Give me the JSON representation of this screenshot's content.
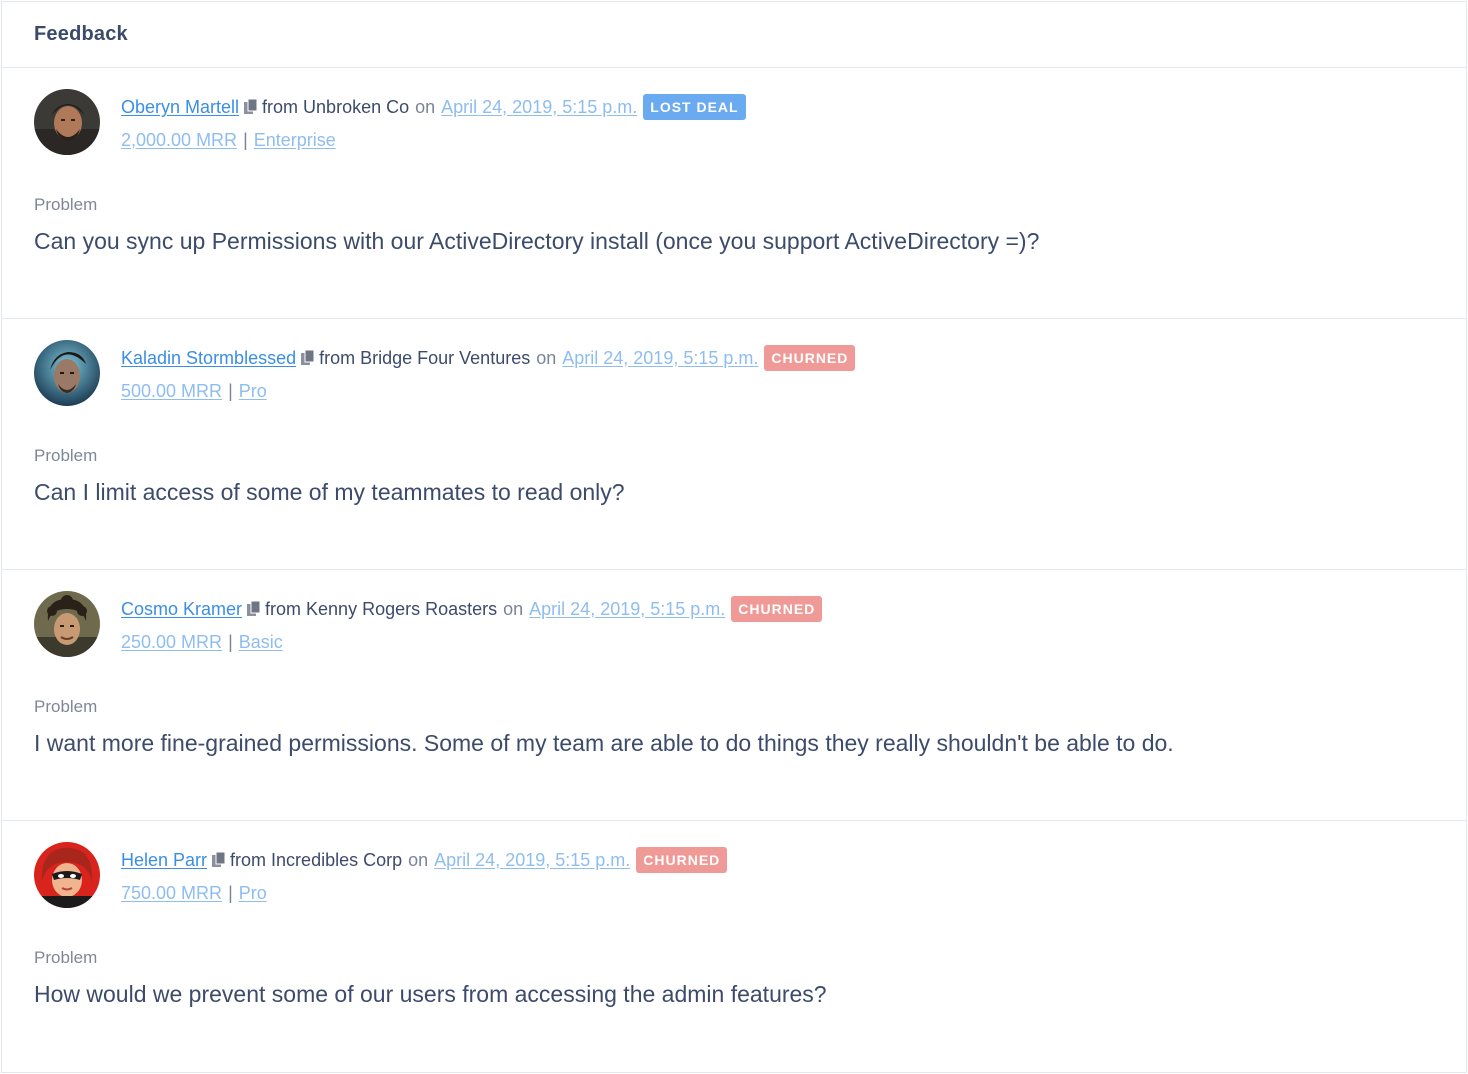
{
  "header": {
    "title": "Feedback"
  },
  "colors": {
    "link": "#3a8ee6",
    "light_link": "#8ebdf0",
    "badge_lost_deal": "#6aaaf0",
    "badge_churned": "#f09a97"
  },
  "feedback": [
    {
      "name": "Oberyn Martell",
      "from_text": "from Unbroken Co",
      "on_text": "on",
      "date": "April 24, 2019, 5:15 p.m.",
      "badge": "LOST DEAL",
      "badge_type": "lost-deal",
      "mrr": "2,000.00 MRR",
      "sep": "|",
      "plan": "Enterprise",
      "label": "Problem",
      "problem": "Can you sync up Permissions with our ActiveDirectory install (once you support ActiveDirectory =)?",
      "avatar_icon": "avatar-dark-hair-beard-icon"
    },
    {
      "name": "Kaladin Stormblessed",
      "from_text": "from Bridge Four Ventures",
      "on_text": "on",
      "date": "April 24, 2019, 5:15 p.m.",
      "badge": "CHURNED",
      "badge_type": "churned",
      "mrr": "500.00 MRR",
      "sep": "|",
      "plan": "Pro",
      "label": "Problem",
      "problem": "Can I limit access of some of my teammates to read only?",
      "avatar_icon": "avatar-blue-storm-icon"
    },
    {
      "name": "Cosmo Kramer",
      "from_text": "from Kenny Rogers Roasters",
      "on_text": "on",
      "date": "April 24, 2019, 5:15 p.m.",
      "badge": "CHURNED",
      "badge_type": "churned",
      "mrr": "250.00 MRR",
      "sep": "|",
      "plan": "Basic",
      "label": "Problem",
      "problem": "I want more fine-grained permissions. Some of my team are able to do things they really shouldn't be able to do.",
      "avatar_icon": "avatar-curly-hair-icon"
    },
    {
      "name": "Helen Parr",
      "from_text": "from Incredibles Corp",
      "on_text": "on",
      "date": "April 24, 2019, 5:15 p.m.",
      "badge": "CHURNED",
      "badge_type": "churned",
      "mrr": "750.00 MRR",
      "sep": "|",
      "plan": "Pro",
      "label": "Problem",
      "problem": "How would we prevent some of our users from accessing the admin features?",
      "avatar_icon": "avatar-red-hero-mask-icon"
    }
  ]
}
